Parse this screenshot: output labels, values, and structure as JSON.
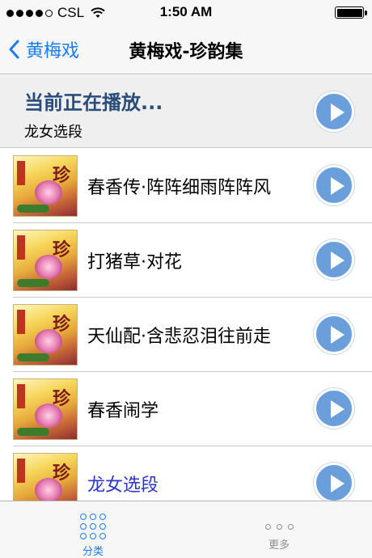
{
  "status_bar": {
    "carrier": "CSL",
    "time": "1:50 AM",
    "signal_bars_filled": 4,
    "signal_bars_total": 5,
    "battery_level": 1.0
  },
  "nav": {
    "back_label": "黄梅戏",
    "title": "黄梅戏-珍韵集"
  },
  "now_playing": {
    "title": "当前正在播放...",
    "track": "龙女选段"
  },
  "tracks": [
    {
      "title": "春香传·阵阵细雨阵阵风",
      "active": false
    },
    {
      "title": "打猪草·对花",
      "active": false
    },
    {
      "title": "天仙配·含悲忍泪往前走",
      "active": false
    },
    {
      "title": "春香闹学",
      "active": false
    },
    {
      "title": "龙女选段",
      "active": true
    }
  ],
  "thumbnail_glyph": "珍",
  "tab_bar": {
    "tabs": [
      {
        "label": "分类",
        "icon": "grid-icon",
        "selected": true
      },
      {
        "label": "更多",
        "icon": "more-icon",
        "selected": false
      }
    ]
  },
  "colors": {
    "accent": "#1a7cf5",
    "play_button": "#6a9fdc",
    "now_playing_title": "#2b4c7a",
    "active_track": "#2a36c9"
  }
}
